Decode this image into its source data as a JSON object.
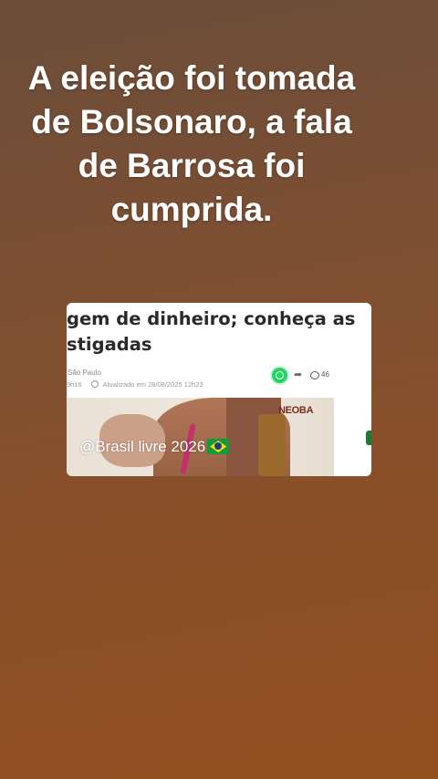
{
  "headline": {
    "lines": [
      "A eleição foi tomada",
      "de Bolsonaro, a fala",
      "de Barrosa foi",
      "cumprida."
    ]
  },
  "article": {
    "title_lines": [
      "gem de dinheiro; conheça as",
      "stigadas"
    ],
    "city": "São Paulo",
    "time": "9h16",
    "updated": "Atualizado em 28/08/2025 12h23",
    "comment_count": "46",
    "photo_logo": "NEOBA"
  },
  "watermark": {
    "text": "@Brasil livre 2026",
    "icon": "brazil-flag-icon"
  }
}
